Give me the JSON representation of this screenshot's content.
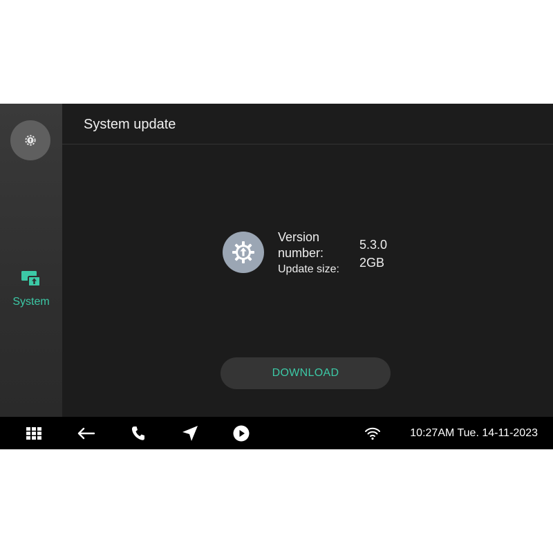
{
  "header": {
    "title": "System update"
  },
  "sidebar": {
    "top_icon": "settings-update-icon",
    "items": [
      {
        "label": "System",
        "icon": "system-update-icon",
        "active": true
      }
    ]
  },
  "update": {
    "version_label": "Version number:",
    "version_value": "5.3.0",
    "size_label": "Update size:",
    "size_value": "2GB",
    "icon": "gear-upload-icon"
  },
  "download": {
    "label": "DOWNLOAD"
  },
  "taskbar": {
    "icons": [
      "apps-grid-icon",
      "back-arrow-icon",
      "phone-icon",
      "navigation-icon",
      "play-icon",
      "wifi-icon"
    ],
    "clock": "10:27AM Tue. 14-11-2023"
  },
  "colors": {
    "accent": "#3cc9a6",
    "background": "#1c1c1c",
    "taskbar": "#000000"
  }
}
